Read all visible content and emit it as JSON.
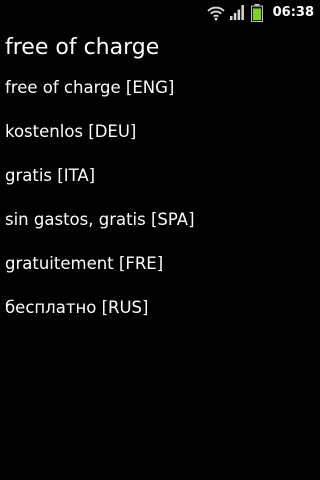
{
  "status_bar": {
    "time": "06:38",
    "icons": [
      "wifi-icon",
      "signal-icon",
      "battery-icon"
    ],
    "battery_color": "#7ed321"
  },
  "page": {
    "title": "free of charge"
  },
  "translations": [
    {
      "text": "free of charge [ENG]"
    },
    {
      "text": "kostenlos [DEU]"
    },
    {
      "text": "gratis [ITA]"
    },
    {
      "text": "sin gastos, gratis [SPA]"
    },
    {
      "text": "gratuitement [FRE]"
    },
    {
      "text": "бесплатно [RUS]"
    }
  ]
}
